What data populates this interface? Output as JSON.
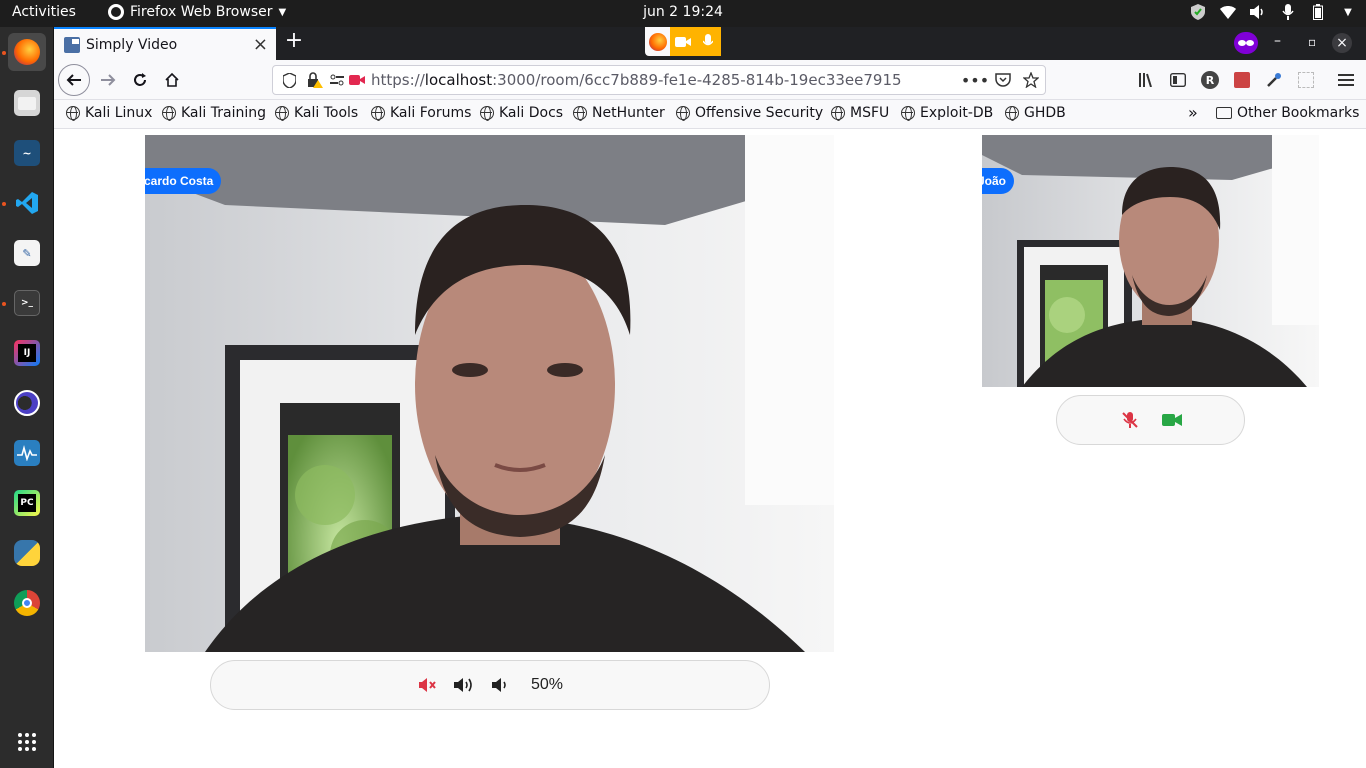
{
  "system": {
    "activities": "Activities",
    "app_menu": "Firefox Web Browser",
    "clock": "jun 2  19:24"
  },
  "browser": {
    "tab_title": "Simply Video",
    "url_prefix": "https://",
    "url_host": "localhost",
    "url_rest": ":3000/room/6cc7b889-fe1e-4285-814b-19ec33ee7915",
    "bookmarks": [
      {
        "label": "Kali Linux"
      },
      {
        "label": "Kali Training"
      },
      {
        "label": "Kali Tools"
      },
      {
        "label": "Kali Forums"
      },
      {
        "label": "Kali Docs"
      },
      {
        "label": "NetHunter"
      },
      {
        "label": "Offensive Security"
      },
      {
        "label": "MSFU"
      },
      {
        "label": "Exploit-DB"
      },
      {
        "label": "GHDB"
      }
    ],
    "other_bookmarks": "Other Bookmarks",
    "profile_initial": "R"
  },
  "room": {
    "main_participant": "Ricardo Costa",
    "side_participant": "João",
    "volume_label": "50%"
  },
  "colors": {
    "accent": "#0d6efd",
    "muted_red": "#dc3545",
    "video_green": "#28a745"
  }
}
